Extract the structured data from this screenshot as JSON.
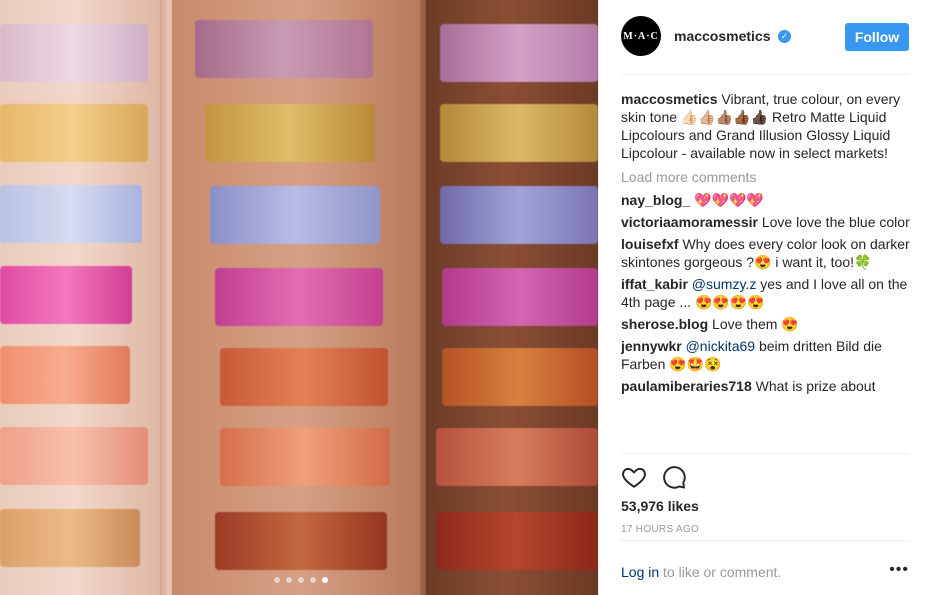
{
  "post": {
    "username": "maccosmetics",
    "avatar_text": "M·A·C",
    "verified_glyph": "✓",
    "follow_label": "Follow"
  },
  "caption": {
    "username": "maccosmetics",
    "text": "Vibrant, true colour, on every skin tone 👍🏻👍🏼👍🏽👍🏾👍🏿 Retro Matte Liquid Lipcolours and Grand Illusion Glossy Liquid Lipcolour - available now in select markets!"
  },
  "load_more": "Load more comments",
  "comments": [
    {
      "user": "nay_blog_",
      "text": " 💖💖💖💖"
    },
    {
      "user": "victoriaamoramessir",
      "text": " Love love the blue color"
    },
    {
      "user": "louisefxf",
      "text": " Why does every color look on darker skintones gorgeous ?😍 i want it, too!🍀"
    },
    {
      "user": "iffat_kabir",
      "mention": " @sumzy.z",
      "text": " yes and I love all on the 4th page ... 😍😍😍😍"
    },
    {
      "user": "sherose.blog",
      "text": " Love them 😍"
    },
    {
      "user": "jennywkr",
      "mention": " @nickita69",
      "text": " beim dritten Bild die Farben 😍🤩😵"
    },
    {
      "user": "paulamiberaries718",
      "text": " What is prize about"
    }
  ],
  "likes": "53,976 likes",
  "time": "17 HOURS AGO",
  "footer": {
    "login_link": "Log in",
    "login_rest": " to like or comment.",
    "more": "•••"
  },
  "icons": {
    "like": "heart-outline-icon",
    "comment": "speech-bubble-icon"
  },
  "colors": {
    "accent": "#3897f0",
    "link": "#003569",
    "muted": "#999999"
  },
  "carousel": {
    "count": 5,
    "active_index": 4
  }
}
